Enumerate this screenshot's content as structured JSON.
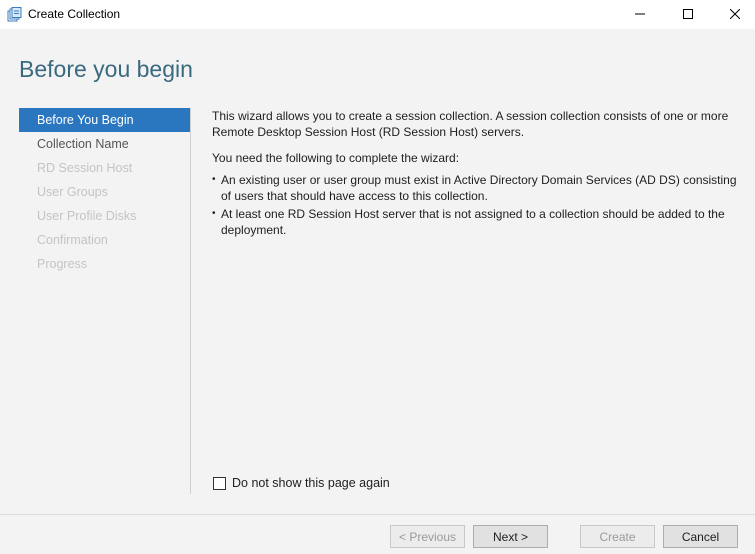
{
  "window": {
    "title": "Create Collection",
    "app_icon": "server-collection-icon"
  },
  "page": {
    "heading": "Before you begin"
  },
  "nav": {
    "items": [
      {
        "label": "Before You Begin",
        "state": "active"
      },
      {
        "label": "Collection Name",
        "state": "enabled"
      },
      {
        "label": "RD Session Host",
        "state": "disabled"
      },
      {
        "label": "User Groups",
        "state": "disabled"
      },
      {
        "label": "User Profile Disks",
        "state": "disabled"
      },
      {
        "label": "Confirmation",
        "state": "disabled"
      },
      {
        "label": "Progress",
        "state": "disabled"
      }
    ]
  },
  "body": {
    "intro": "This wizard allows you to create a session collection. A session collection consists of one or more Remote Desktop Session Host (RD Session Host) servers.",
    "need_heading": "You need the following to complete the wizard:",
    "bullets": [
      "An existing user or user group must exist in Active Directory Domain Services (AD DS) consisting of users that should have access to this collection.",
      "At least one RD Session Host server that is not assigned to a collection should be added to the deployment."
    ]
  },
  "checkbox": {
    "label": "Do not show this page again",
    "checked": false
  },
  "footer": {
    "previous_label": "< Previous",
    "next_label": "Next >",
    "create_label": "Create",
    "cancel_label": "Cancel"
  },
  "colors": {
    "accent": "#2a77c0",
    "heading": "#3a6a80",
    "background": "#f3f3f3"
  }
}
